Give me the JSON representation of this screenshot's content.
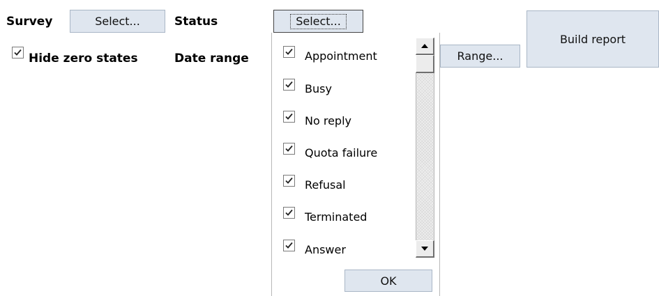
{
  "filters": {
    "survey_label": "Survey",
    "survey_button": "Select...",
    "status_label": "Status",
    "status_button": "Select...",
    "hide_zero_label": "Hide zero states",
    "hide_zero_checked": true,
    "date_range_label": "Date range",
    "range_button": "Range...",
    "build_report_button": "Build report"
  },
  "status_dropdown": {
    "options": [
      {
        "label": "Appointment",
        "checked": true
      },
      {
        "label": "Busy",
        "checked": true
      },
      {
        "label": "No reply",
        "checked": true
      },
      {
        "label": "Quota failure",
        "checked": true
      },
      {
        "label": "Refusal",
        "checked": true
      },
      {
        "label": "Terminated",
        "checked": true
      },
      {
        "label": "Answer",
        "checked": true
      }
    ],
    "ok_button": "OK",
    "icons": {
      "scroll_up": "triangle-up-icon",
      "scroll_down": "triangle-down-icon",
      "check": "checkmark-icon"
    }
  },
  "colors": {
    "button_bg": "#dfe6ef",
    "button_border": "#a9b6c6"
  }
}
